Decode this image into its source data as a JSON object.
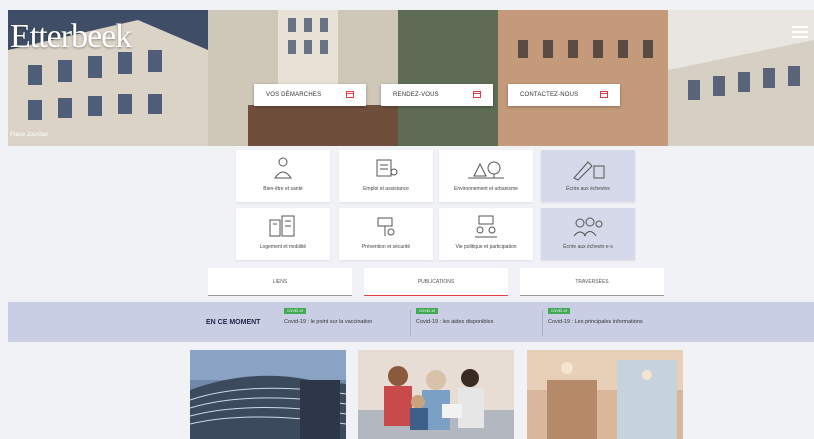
{
  "hero": {
    "logo": "Etterbeek",
    "caption": "Place Jourdan",
    "buttons": [
      {
        "label": "VOS DÉMARCHES"
      },
      {
        "label": "RENDEZ-VOUS"
      },
      {
        "label": "CONTACTEZ-NOUS"
      }
    ]
  },
  "tiles": [
    {
      "label": "Bien-être et santé",
      "icon": "person-heart-icon"
    },
    {
      "label": "Emploi et assistance",
      "icon": "document-people-icon"
    },
    {
      "label": "Environnement et urbanisme",
      "icon": "trees-icon"
    },
    {
      "label": "Écrire aux échevins",
      "icon": "pen-building-icon"
    },
    {
      "label": "Logement et mobilité",
      "icon": "buildings-icon"
    },
    {
      "label": "Prévention et sécurité",
      "icon": "shield-camera-icon"
    },
    {
      "label": "Vie politique et participation",
      "icon": "speech-people-icon"
    },
    {
      "label": "Écrire aux échevin·e·s",
      "icon": "people-group-icon"
    }
  ],
  "tabs": [
    {
      "label": "LIENS"
    },
    {
      "label": "PUBLICATIONS"
    },
    {
      "label": "TRAVERSÉES"
    }
  ],
  "news": {
    "title": "EN CE MOMENT",
    "items": [
      {
        "badge": "COVID-19",
        "text": "Covid-19 : le point sur la vaccination"
      },
      {
        "badge": "COVID-19",
        "text": "Covid-19 : les aides disponibles"
      },
      {
        "badge": "COVID-19",
        "text": "Covid-19 : Les principales informations"
      }
    ]
  },
  "colors": {
    "accent": "#e53a48",
    "band": "#c9cee4",
    "tile_alt": "#d5d9ea",
    "badge": "#3faa52"
  }
}
